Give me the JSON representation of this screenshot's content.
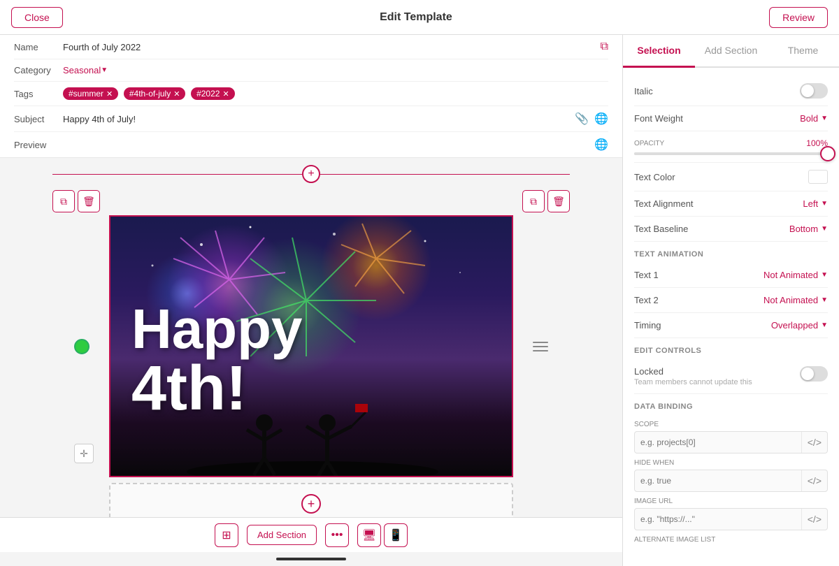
{
  "topbar": {
    "close_label": "Close",
    "title": "Edit Template",
    "review_label": "Review"
  },
  "meta": {
    "name_label": "Name",
    "name_value": "Fourth of July 2022",
    "category_label": "Category",
    "category_value": "Seasonal",
    "tags_label": "Tags",
    "tags": [
      "#summer",
      "#4th-of-july",
      "#2022"
    ],
    "subject_label": "Subject",
    "subject_value": "Happy 4th of July!",
    "preview_label": "Preview"
  },
  "canvas": {
    "text1": "Happy",
    "text2": "4th!"
  },
  "bottom_toolbar": {
    "grid_icon": "⊞",
    "add_section_label": "Add Section",
    "more_label": "...",
    "desktop_icon": "🖥",
    "mobile_icon": "📱"
  },
  "right_panel": {
    "tabs": [
      "Selection",
      "Add Section",
      "Theme"
    ],
    "active_tab": "Selection",
    "properties": {
      "italic_label": "Italic",
      "font_weight_label": "Font Weight",
      "font_weight_value": "Bold",
      "opacity_label": "OPACITY",
      "opacity_value": "100%",
      "text_color_label": "Text Color",
      "text_alignment_label": "Text Alignment",
      "text_alignment_value": "Left",
      "text_baseline_label": "Text Baseline",
      "text_baseline_value": "Bottom"
    },
    "text_animation": {
      "section_label": "Text Animation",
      "text1_label": "Text 1",
      "text1_value": "Not Animated",
      "text2_label": "Text 2",
      "text2_value": "Not Animated",
      "timing_label": "Timing",
      "timing_value": "Overlapped"
    },
    "edit_controls": {
      "section_label": "Edit Controls",
      "locked_label": "Locked",
      "locked_sub": "Team members cannot update this"
    },
    "data_binding": {
      "section_label": "Data Binding",
      "scope_label": "SCOPE",
      "scope_placeholder": "e.g. projects[0]",
      "hide_when_label": "HIDE WHEN",
      "hide_when_placeholder": "e.g. true",
      "image_url_label": "IMAGE URL",
      "image_url_placeholder": "e.g. \"https://...\"",
      "alt_image_label": "ALTERNATE IMAGE LIST"
    }
  }
}
